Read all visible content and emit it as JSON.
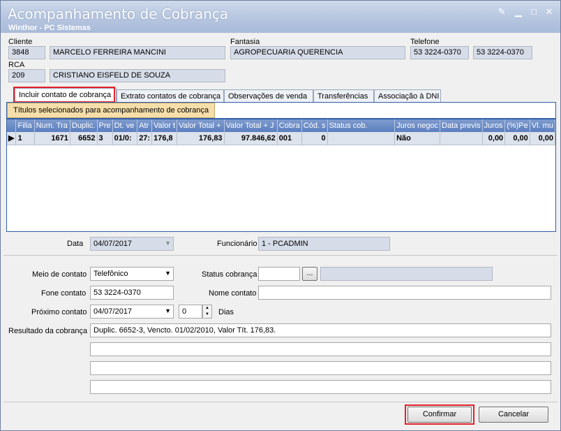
{
  "window": {
    "title": "Acompanhamento de Cobrança",
    "subtitle": "Winthor - PC Sistemas",
    "controls": {
      "edit": "✎",
      "minimize": "▁",
      "maximize": "□",
      "close": "✕"
    }
  },
  "header": {
    "cliente_label": "Cliente",
    "cliente_code": "3848",
    "cliente_name": "MARCELO FERREIRA MANCINI",
    "fantasia_label": "Fantasia",
    "fantasia_value": "AGROPECUARIA QUERENCIA",
    "telefone_label": "Telefone",
    "telefone1": "53 3224-0370",
    "telefone2": "53 3224-0370",
    "rca_label": "RCA",
    "rca_code": "209",
    "rca_name": "CRISTIANO EISFELD DE SOUZA"
  },
  "tabs": [
    {
      "label": "Incluir contato de cobrança"
    },
    {
      "label": "Extrato contatos de cobrança"
    },
    {
      "label": "Observações de venda"
    },
    {
      "label": "Transferências"
    },
    {
      "label": "Associação à DNI"
    }
  ],
  "subtab": "Títulos selecionados para acompanhamento de cobrança",
  "grid": {
    "columns": [
      "",
      "Filia",
      "Num. Tra",
      "Duplic.",
      "Pre",
      "Dt. ve",
      "Atr",
      "Valor t",
      "Valor Total +",
      "Valor Total + J",
      "Cobra",
      "Cód. s",
      "Status cob.",
      "Juros negoc",
      "Data previs",
      "Juros",
      "(%)Pe",
      "Vl. mu"
    ],
    "rows": [
      [
        "▶",
        "1",
        "1671",
        "6652",
        "3",
        "01/0:",
        "27:",
        "176,8",
        "176,83",
        "97.846,62",
        "001",
        "0",
        "",
        "Não",
        "",
        "0,00",
        "0,00",
        "0,00"
      ]
    ]
  },
  "form": {
    "data_label": "Data",
    "data_value": "04/07/2017",
    "funcionario_label": "Funcionário",
    "funcionario_value": "1  -  PCADMIN",
    "meio_label": "Meio de contato",
    "meio_value": "Telefônico",
    "status_label": "Status cobrança",
    "status_code": "",
    "status_desc": "",
    "status_btn": "...",
    "fone_label": "Fone contato",
    "fone_value": "53 3224-0370",
    "nome_label": "Nome contato",
    "nome_value": "",
    "proximo_label": "Próximo contato",
    "proximo_value": "04/07/2017",
    "dias_value": "0",
    "dias_label": "Dias",
    "resultado_label": "Resultado da cobrança",
    "resultado_lines": [
      "Duplic. 6652-3, Vencto. 01/02/2010, Valor Tít. 176,83.",
      "",
      "",
      "",
      ""
    ]
  },
  "buttons": {
    "confirm": "Confirmar",
    "cancel": "Cancelar"
  },
  "colors": {
    "highlight": "#e3202a",
    "title_bg": "#b4c4df",
    "grid_header": "#5c7fbf"
  }
}
